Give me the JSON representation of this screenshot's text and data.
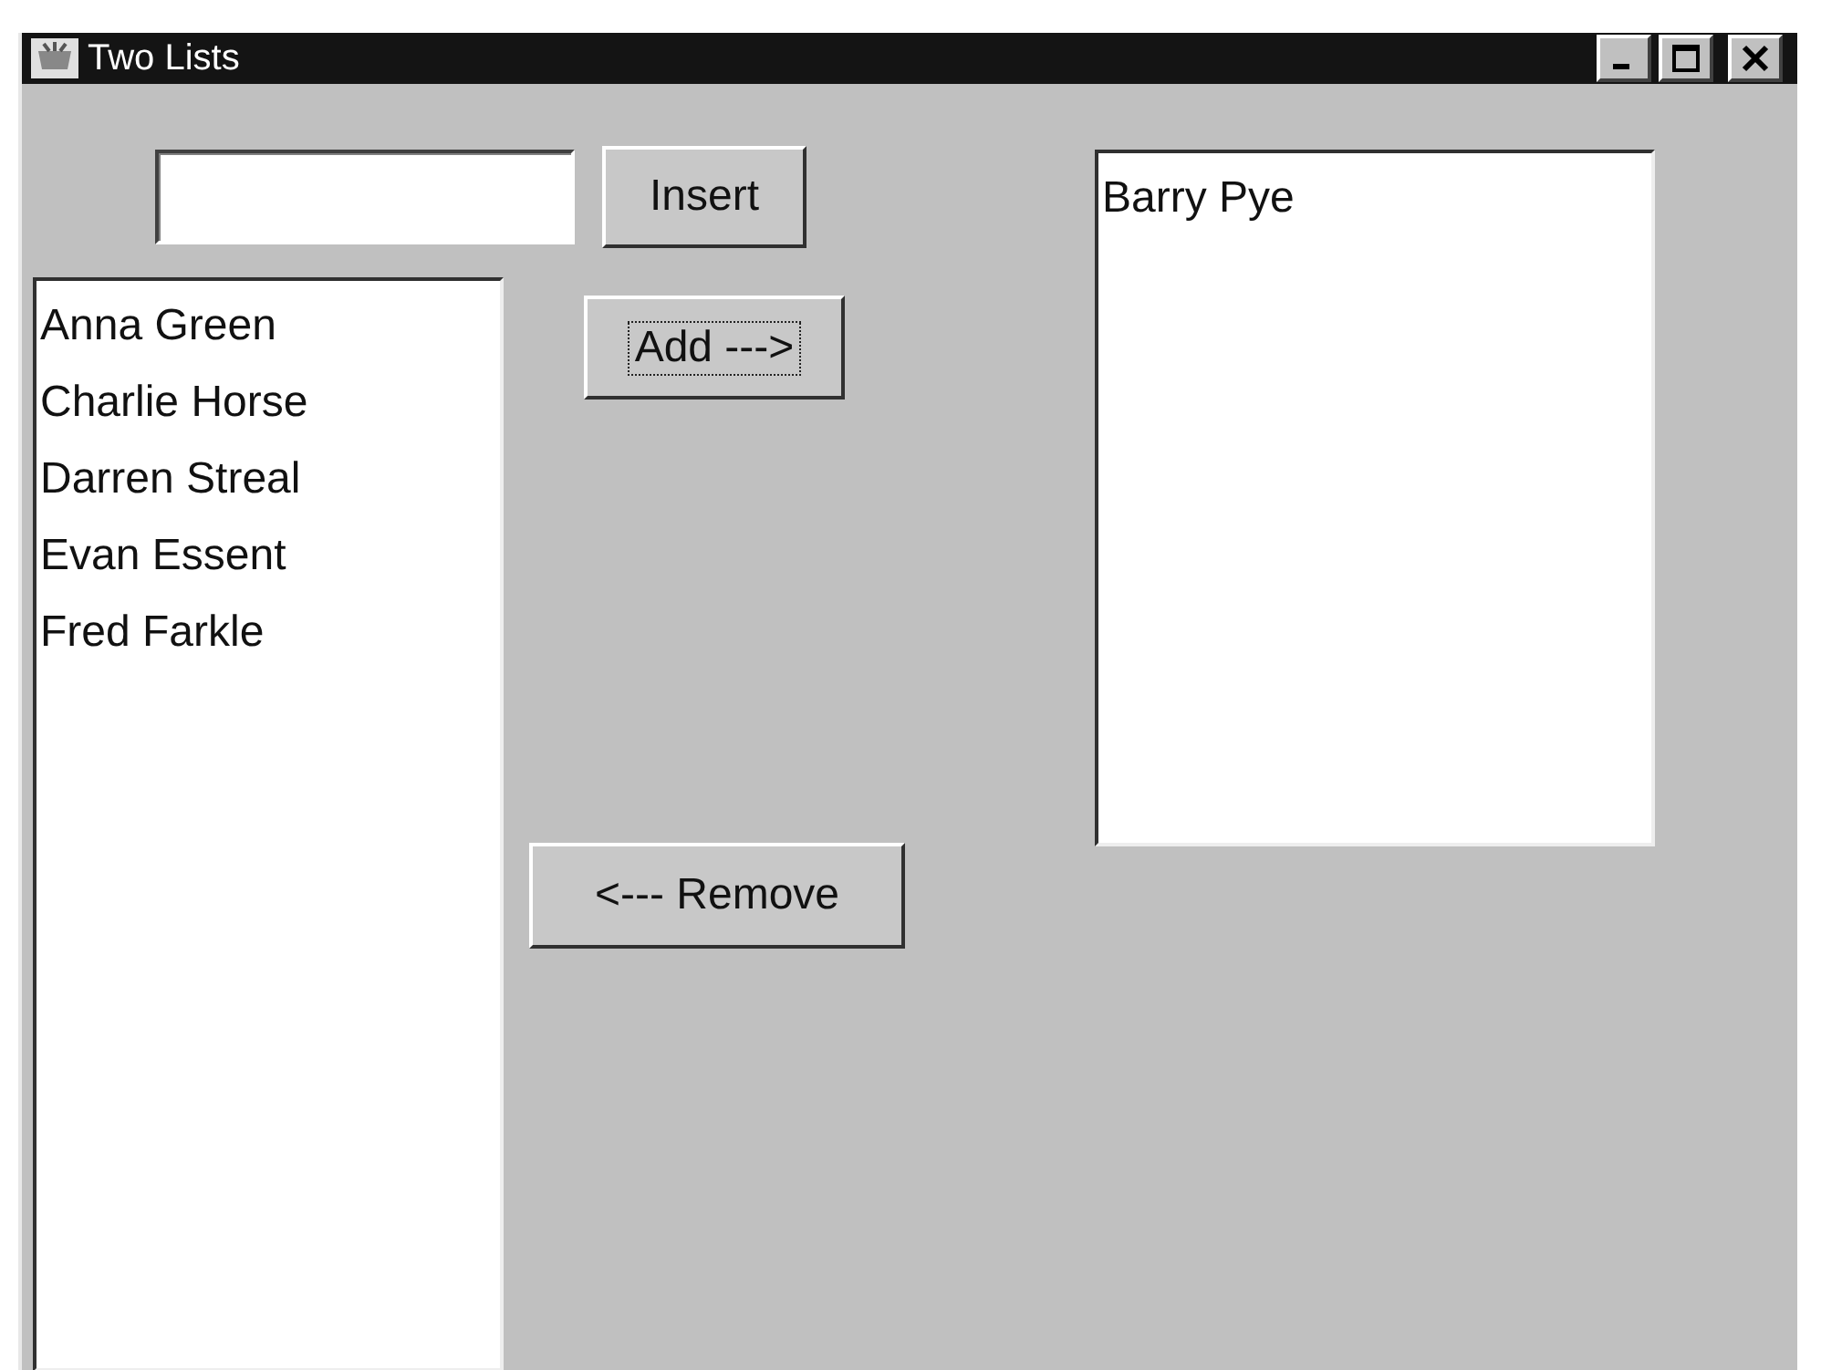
{
  "window": {
    "title": "Two Lists"
  },
  "insert_button": {
    "label": "Insert",
    "focused": false
  },
  "add_button": {
    "label": "Add --->",
    "focused": true
  },
  "remove_button": {
    "label": "<--- Remove",
    "focused": false
  },
  "left_list": {
    "items": [
      "Anna Green",
      "Charlie Horse",
      "Darren Streal",
      "Evan Essent",
      "Fred Farkle"
    ]
  },
  "right_list": {
    "items": [
      "Barry Pye"
    ]
  }
}
